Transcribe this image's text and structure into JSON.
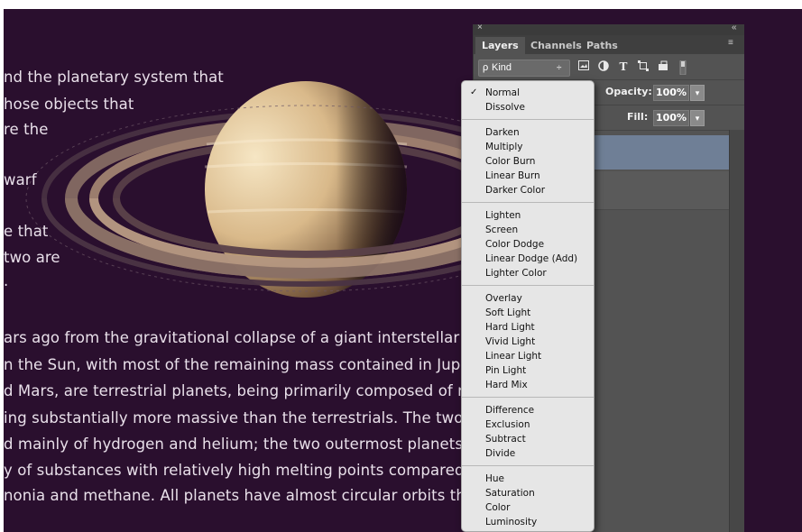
{
  "document": {
    "background_color": "#2a0f2e",
    "text_color": "#e9e0ea",
    "upper_lines": [
      "nd the planetary system that",
      "hose objects that",
      "re the",
      "",
      "warf",
      "",
      "e that",
      "two are",
      "."
    ],
    "lower_lines": [
      "ars ago from the gravitational collapse of a giant interstellar m",
      "n the Sun, with most of the remaining mass contained in Jupit",
      "d Mars, are terrestrial planets, being primarily composed of ro",
      "ing substantially more massive than the terrestrials. The two l",
      "d mainly of hydrogen and helium; the two outermost planets, U",
      "y of substances with relatively high melting points compared",
      "nonia and methane. All planets have almost circular orbits tha"
    ]
  },
  "panel": {
    "close_glyph": "×",
    "collapse_glyph": "«",
    "menu_glyph": "≡",
    "tabs": [
      {
        "label": "Layers",
        "active": true
      },
      {
        "label": "Channels",
        "active": false
      },
      {
        "label": "Paths",
        "active": false
      }
    ],
    "filter": {
      "search_glyph": "ρ",
      "kind_label": "Kind",
      "stepper_glyph": "÷",
      "icons": [
        "image-filter-icon",
        "adjustment-filter-icon",
        "type-filter-icon",
        "shape-filter-icon",
        "smart-object-filter-icon",
        "filter-toggle-icon"
      ]
    },
    "opacity": {
      "label": "Opacity:",
      "value": "100%"
    },
    "fill": {
      "label": "Fill:",
      "value": "100%"
    },
    "dropdown_arrow": "▾",
    "selected_layer_color": "#6f7f96"
  },
  "blend_menu": {
    "checked": "Normal",
    "check_glyph": "✓",
    "groups": [
      [
        "Normal",
        "Dissolve"
      ],
      [
        "Darken",
        "Multiply",
        "Color Burn",
        "Linear Burn",
        "Darker Color"
      ],
      [
        "Lighten",
        "Screen",
        "Color Dodge",
        "Linear Dodge (Add)",
        "Lighter Color"
      ],
      [
        "Overlay",
        "Soft Light",
        "Hard Light",
        "Vivid Light",
        "Linear Light",
        "Pin Light",
        "Hard Mix"
      ],
      [
        "Difference",
        "Exclusion",
        "Subtract",
        "Divide"
      ],
      [
        "Hue",
        "Saturation",
        "Color",
        "Luminosity"
      ]
    ]
  }
}
